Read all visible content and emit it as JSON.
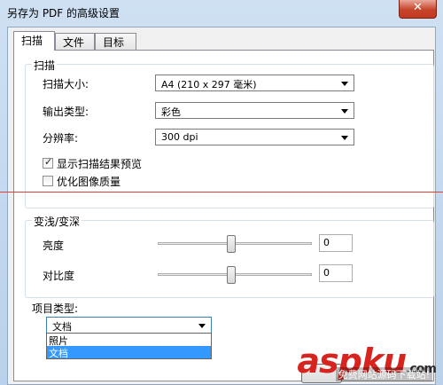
{
  "window": {
    "title": "另存为 PDF 的高级设置",
    "close_symbol": "✕"
  },
  "tabs": [
    {
      "label": "扫描",
      "active": true
    },
    {
      "label": "文件"
    },
    {
      "label": "目标"
    }
  ],
  "scan_group": {
    "title": "扫描",
    "size_label": "扫描大小:",
    "size_value": "A4 (210 x 297 毫米)",
    "output_label": "输出类型:",
    "output_value": "彩色",
    "resolution_label": "分辨率:",
    "resolution_value": "300 dpi",
    "preview_label": "显示扫描结果预览",
    "preview_checked": true,
    "optimize_label": "优化图像质量",
    "optimize_checked": false
  },
  "shade_group": {
    "title": "变浅/变深",
    "brightness_label": "亮度",
    "brightness_value": "0",
    "contrast_label": "对比度",
    "contrast_value": "0"
  },
  "project_type": {
    "label": "项目类型:",
    "selected": "文档",
    "options": [
      "照片",
      "文档"
    ]
  },
  "watermark": {
    "text": "aspku",
    "suffix": ".com",
    "subtext": "免费网站源码下载站!"
  },
  "colors": {
    "accent": "#3399ff",
    "close": "#c7432b",
    "watermark": "#d8241f"
  }
}
